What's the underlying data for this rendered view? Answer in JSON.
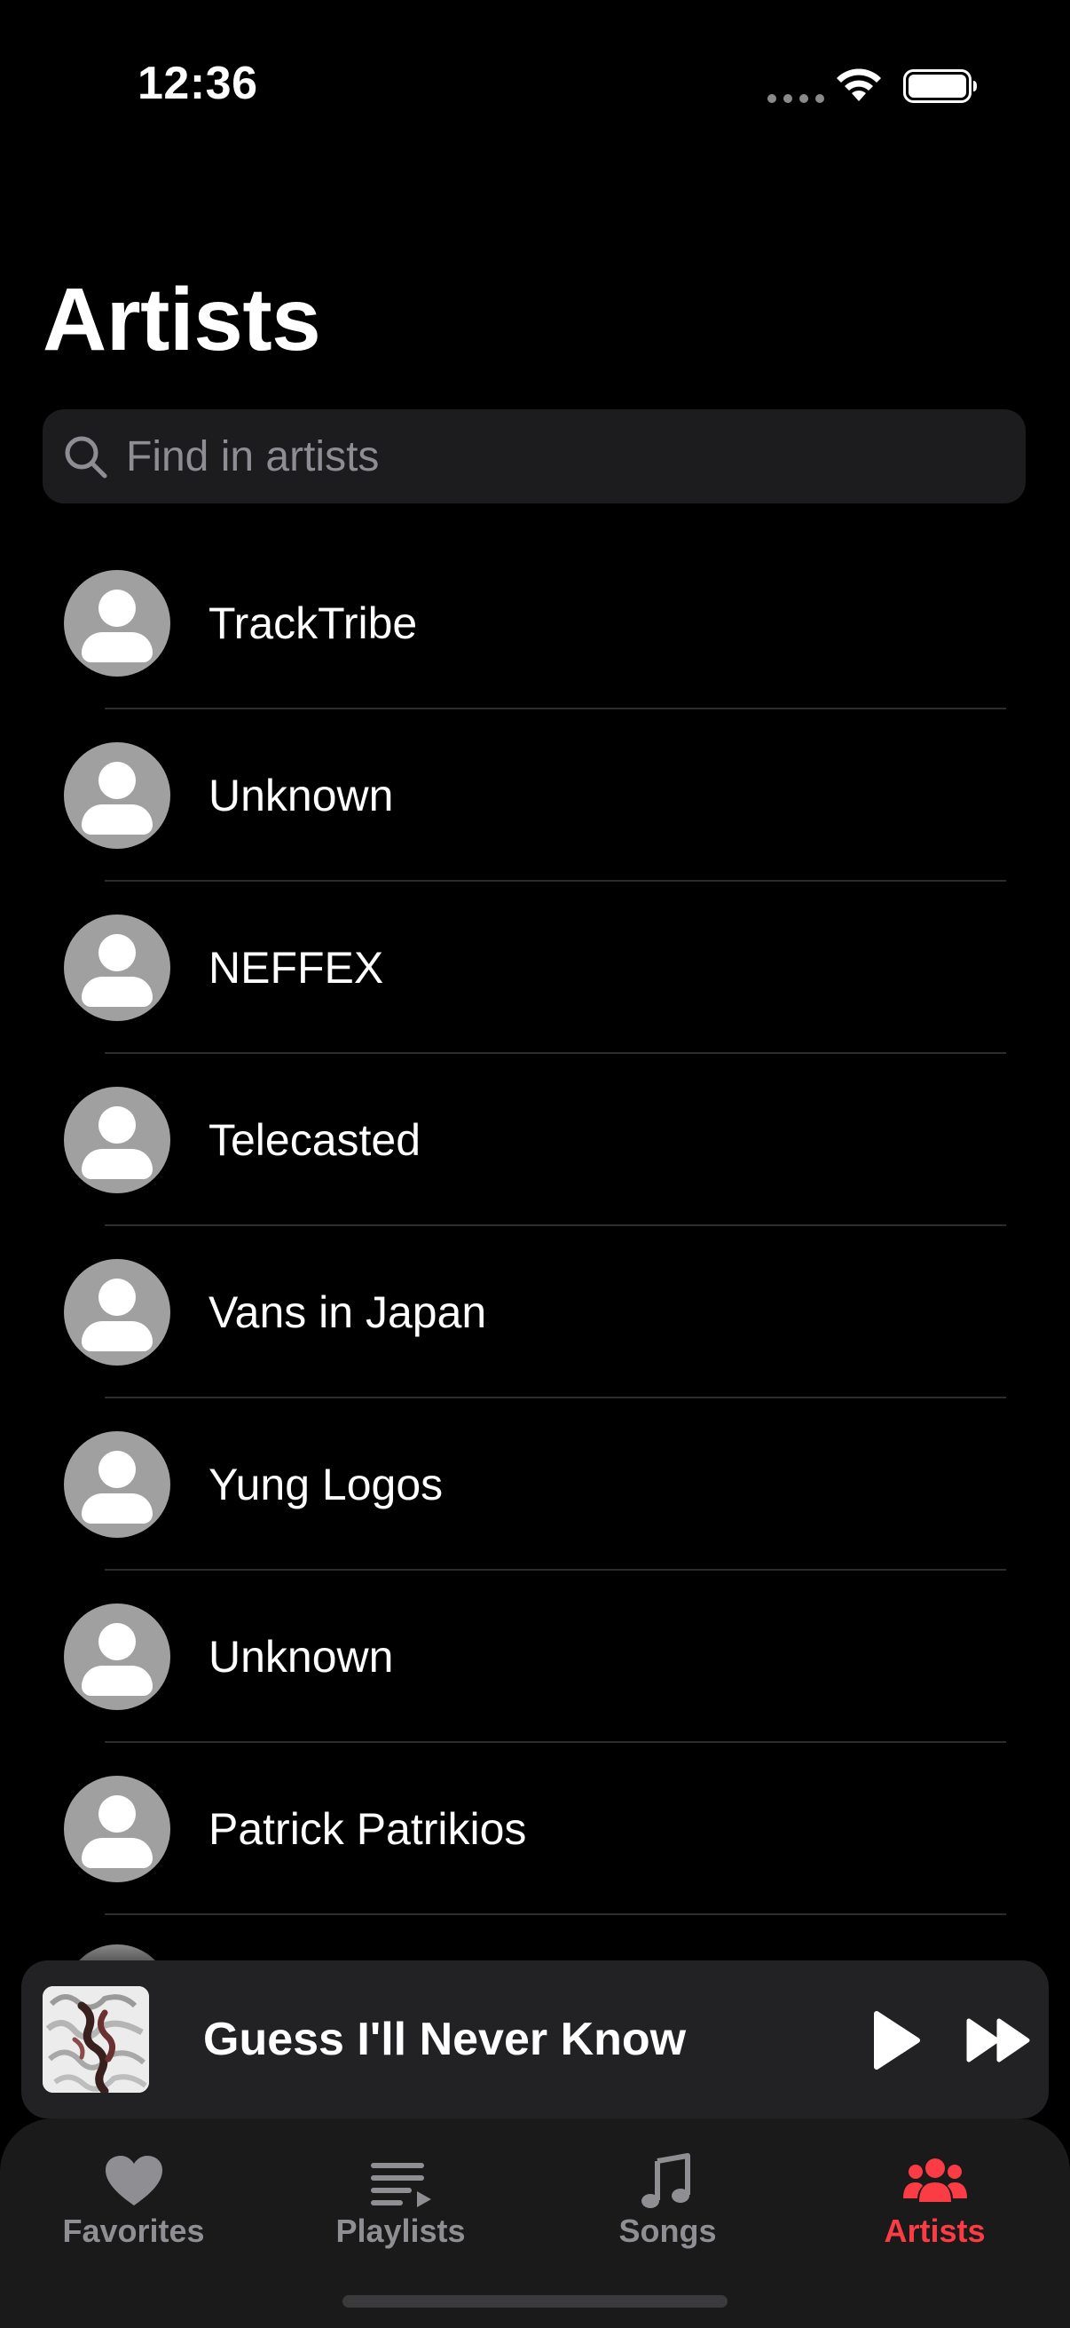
{
  "status_bar": {
    "time": "12:36"
  },
  "page": {
    "title": "Artists"
  },
  "search": {
    "placeholder": "Find in artists",
    "value": ""
  },
  "artists": [
    {
      "name": "TrackTribe"
    },
    {
      "name": "Unknown"
    },
    {
      "name": "NEFFEX"
    },
    {
      "name": "Telecasted"
    },
    {
      "name": "Vans in Japan"
    },
    {
      "name": "Yung Logos"
    },
    {
      "name": "Unknown"
    },
    {
      "name": "Patrick Patrikios"
    }
  ],
  "now_playing": {
    "title": "Guess I'll Never Know",
    "play_icon": "play-icon",
    "forward_icon": "forward-icon"
  },
  "tab_bar": {
    "tabs": [
      {
        "label": "Favorites",
        "icon": "heart-icon",
        "active": false
      },
      {
        "label": "Playlists",
        "icon": "playlist-icon",
        "active": false
      },
      {
        "label": "Songs",
        "icon": "music-note-icon",
        "active": false
      },
      {
        "label": "Artists",
        "icon": "people-icon",
        "active": true
      }
    ]
  },
  "colors": {
    "background": "#000000",
    "accent": "#fc3c44",
    "inactive": "#8e8e93",
    "surface": "#1c1c1e"
  }
}
